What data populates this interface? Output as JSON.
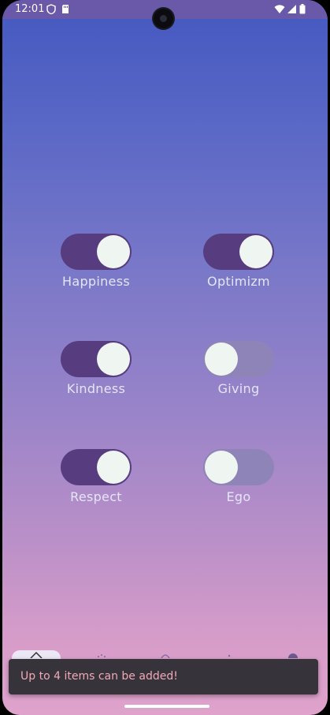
{
  "status_bar": {
    "time": "12:01",
    "icons": [
      "shield-icon",
      "sd-card-icon",
      "wifi-icon",
      "signal-icon",
      "battery-icon"
    ]
  },
  "toggles": [
    {
      "label": "Happiness",
      "on": true
    },
    {
      "label": "Optimizm",
      "on": true
    },
    {
      "label": "Kindness",
      "on": true
    },
    {
      "label": "Giving",
      "on": false
    },
    {
      "label": "Respect",
      "on": true
    },
    {
      "label": "Ego",
      "on": false
    }
  ],
  "bottom_nav": {
    "items": [
      "home-icon",
      "nav-item-2-icon",
      "nav-item-3-icon",
      "nav-item-4-icon",
      "settings-icon"
    ]
  },
  "snackbar": {
    "message": "Up to 4 items can be added!"
  },
  "colors": {
    "toggle_on": "#573d80",
    "toggle_off": "#8e84b8",
    "knob": "#eff5f1",
    "snackbar_bg": "#36333a",
    "snackbar_text": "#f2a8b7"
  }
}
